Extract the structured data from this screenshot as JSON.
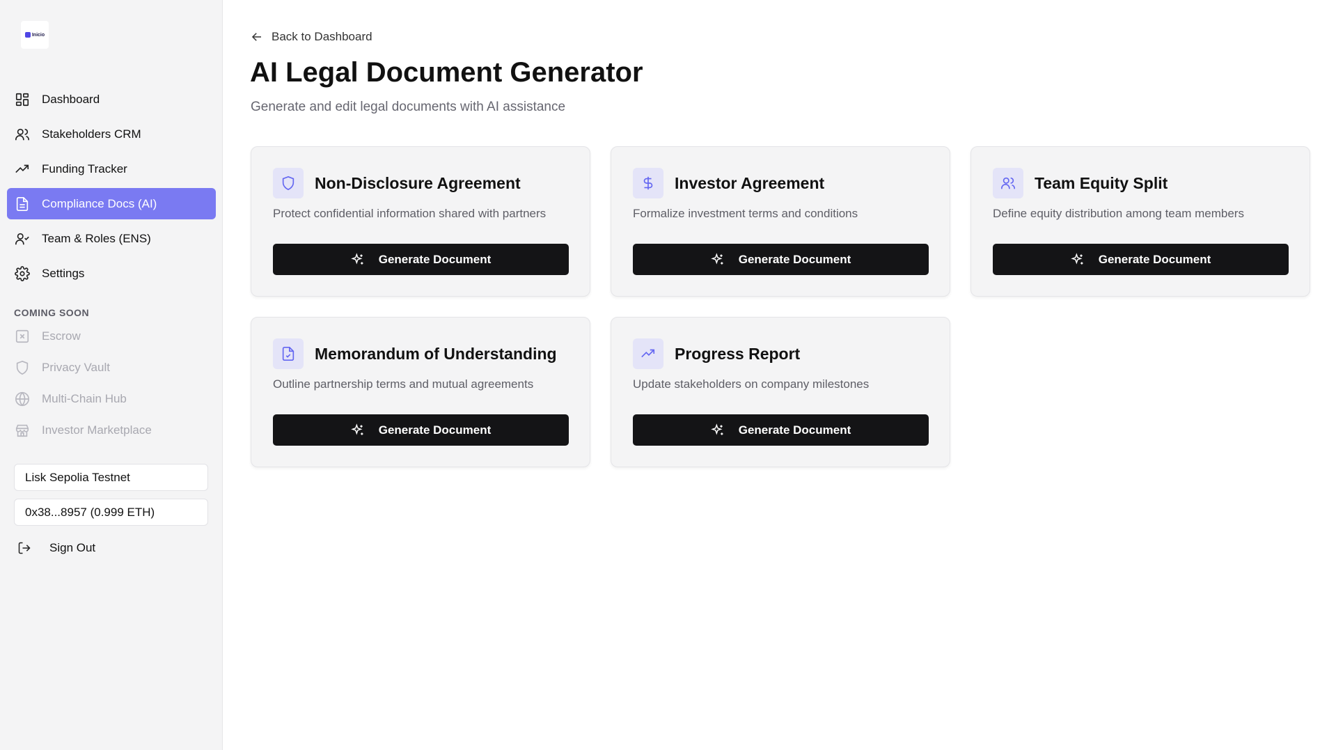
{
  "app": {
    "logo_text": "Inicio"
  },
  "sidebar": {
    "items": [
      {
        "label": "Dashboard",
        "icon": "layout-grid-icon"
      },
      {
        "label": "Stakeholders CRM",
        "icon": "users-icon"
      },
      {
        "label": "Funding Tracker",
        "icon": "trending-up-icon"
      },
      {
        "label": "Compliance Docs (AI)",
        "icon": "file-text-icon",
        "active": true
      },
      {
        "label": "Team & Roles (ENS)",
        "icon": "user-check-icon"
      },
      {
        "label": "Settings",
        "icon": "gear-icon"
      }
    ],
    "coming_soon_label": "COMING SOON",
    "coming_soon": [
      {
        "label": "Escrow",
        "icon": "square-x-icon"
      },
      {
        "label": "Privacy Vault",
        "icon": "shield-icon"
      },
      {
        "label": "Multi-Chain Hub",
        "icon": "globe-icon"
      },
      {
        "label": "Investor Marketplace",
        "icon": "store-icon"
      }
    ],
    "network": "Lisk Sepolia Testnet",
    "wallet": "0x38...8957 (0.999 ETH)",
    "sign_out": "Sign Out"
  },
  "main": {
    "back_label": "Back to Dashboard",
    "title": "AI Legal Document Generator",
    "subtitle": "Generate and edit legal documents with AI assistance",
    "cards": [
      {
        "title": "Non-Disclosure Agreement",
        "description": "Protect confidential information shared with partners",
        "button": "Generate Document",
        "icon": "shield-icon"
      },
      {
        "title": "Investor Agreement",
        "description": "Formalize investment terms and conditions",
        "button": "Generate Document",
        "icon": "dollar-icon"
      },
      {
        "title": "Team Equity Split",
        "description": "Define equity distribution among team members",
        "button": "Generate Document",
        "icon": "users-icon"
      },
      {
        "title": "Memorandum of Understanding",
        "description": "Outline partnership terms and mutual agreements",
        "button": "Generate Document",
        "icon": "file-check-icon"
      },
      {
        "title": "Progress Report",
        "description": "Update stakeholders on company milestones",
        "button": "Generate Document",
        "icon": "trending-up-icon"
      }
    ]
  },
  "colors": {
    "accent": "#7a7af2",
    "icon_accent": "#6366f1",
    "button_bg": "#141416",
    "sidebar_bg": "#f4f4f5"
  }
}
